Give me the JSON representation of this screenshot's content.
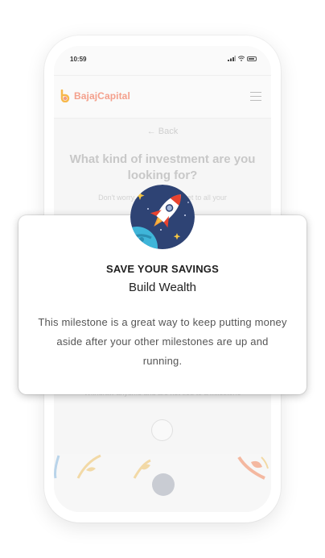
{
  "status_bar": {
    "time": "10:59"
  },
  "brand": {
    "name": "BajajCapital",
    "color": "#f4a08c"
  },
  "background_page": {
    "back_label": "← Back",
    "question": "What kind of investment are you looking for?",
    "hint": "Don't worry, we'll help you get to all your",
    "footer_hint": "Withdraw anytime and are not tied to a milestone"
  },
  "modal": {
    "title": "SAVE YOUR SAVINGS",
    "subtitle": "Build Wealth",
    "body": "This milestone is a great way to keep putting money aside after your other milestones are up and running.",
    "icon": "rocket-icon"
  },
  "colors": {
    "badge_bg": "#2e4374",
    "rocket_red": "#e8432f",
    "star": "#f4c542"
  }
}
